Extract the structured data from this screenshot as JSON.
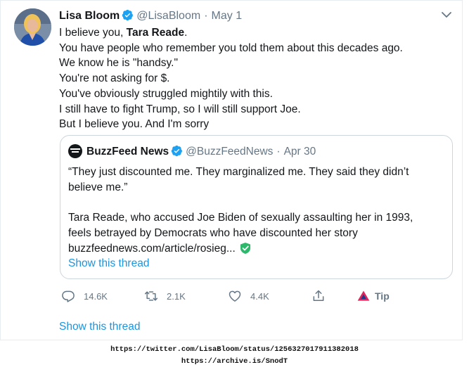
{
  "tweet": {
    "author_name": "Lisa Bloom",
    "author_handle": "@LisaBloom",
    "separator": "·",
    "date": "May 1",
    "lines": [
      {
        "pre": "I believe you, ",
        "bold": "Tara Reade",
        "post": "."
      },
      "You have people who remember you told them about this decades ago.",
      "We know he is \"handsy.\"",
      "You're not asking for $.",
      "You've obviously struggled mightily with this.",
      "I still have to fight Trump, so I will still support Joe.",
      "But I believe you. And I'm sorry"
    ]
  },
  "quote": {
    "author_name": "BuzzFeed News",
    "author_handle": "@BuzzFeedNews",
    "separator": "·",
    "date": "Apr 30",
    "lines": [
      "“They just discounted me. They marginalized me. They said they didn’t",
      "believe me.”",
      "",
      "Tara Reade, who accused Joe Biden of sexually assaulting her in 1993,",
      "feels betrayed by Democrats who have discounted her story",
      "buzzfeednews.com/article/rosieg..."
    ],
    "show_thread": "Show this thread"
  },
  "actions": {
    "replies": "14.6K",
    "retweets": "2.1K",
    "likes": "4.4K",
    "tip": "Tip"
  },
  "show_thread": "Show this thread",
  "footer": {
    "line1": "https://twitter.com/LisaBloom/status/1256327017911382018",
    "line2": "https://archive.is/SnodT"
  },
  "colors": {
    "link": "#1b95e0",
    "verified": "#1da1f2",
    "muted": "#657786",
    "tip_red": "#e0245e"
  }
}
